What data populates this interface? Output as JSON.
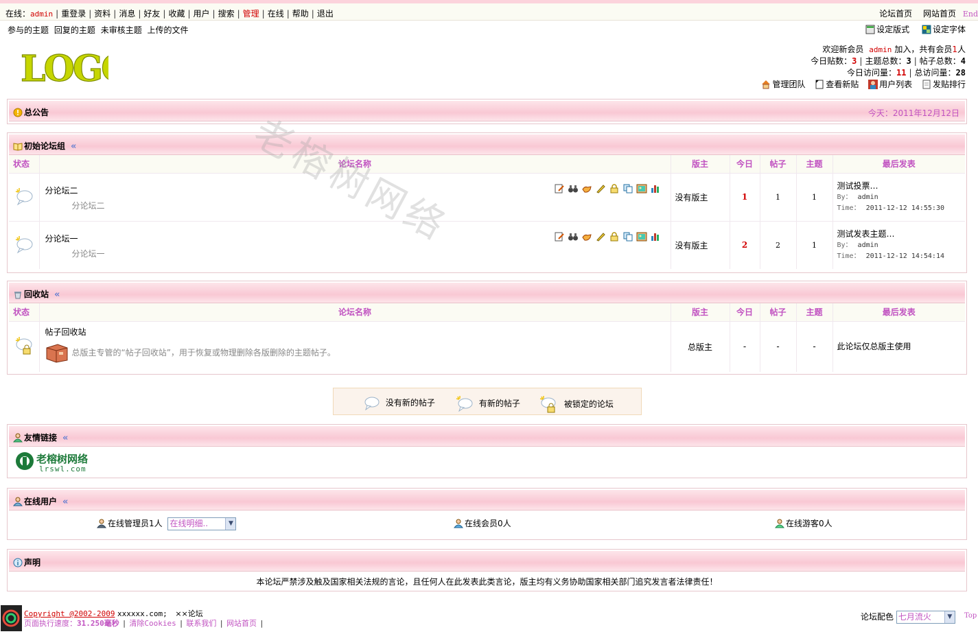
{
  "topbar": {
    "online_label": "在线：",
    "user": "admin",
    "menu": [
      "重登录",
      "资料",
      "消息",
      "好友",
      "收藏",
      "用户",
      "搜索",
      "管理",
      "在线",
      "帮助",
      "退出"
    ],
    "right_links": [
      "论坛首页",
      "网站首页",
      "End"
    ]
  },
  "subbar": {
    "links": [
      "参与的主题",
      "回复的主题",
      "未审核主题",
      "上传的文件"
    ]
  },
  "style_links": {
    "layout": "设定版式",
    "font": "设定字体"
  },
  "logo_text": "LOGO",
  "stats": {
    "welcome_pre": "欢迎新会员",
    "new_member": "admin",
    "welcome_mid": "加入，共有会员",
    "member_count": "1",
    "welcome_post": "人",
    "today_posts_label": "今日贴数：",
    "today_posts": "3",
    "topics_label": "主题总数：",
    "topics": "3",
    "posts_label": "帖子总数：",
    "posts": "4",
    "today_visits_label": "今日访问量：",
    "today_visits": "11",
    "total_visits_label": "总访问量：",
    "total_visits": "28",
    "links": [
      "管理团队",
      "查看新贴",
      "用户列表",
      "发贴排行"
    ]
  },
  "announcement": {
    "title": "总公告",
    "date": "今天：2011年12月12日"
  },
  "columns": [
    "状态",
    "论坛名称",
    "版主",
    "今日",
    "帖子",
    "主题",
    "最后发表"
  ],
  "group1": {
    "title": "初始论坛组",
    "forums": [
      {
        "name": "分论坛二",
        "desc": "分论坛二",
        "moderator": "没有版主",
        "today": "1",
        "posts": "1",
        "topics": "1",
        "last_title": "测试投票…",
        "by_label": "By：",
        "by": "admin",
        "time_label": "Time：",
        "time": "2011-12-12 14:55:30"
      },
      {
        "name": "分论坛一",
        "desc": "分论坛一",
        "moderator": "没有版主",
        "today": "2",
        "posts": "2",
        "topics": "1",
        "last_title": "测试发表主题…",
        "by_label": "By：",
        "by": "admin",
        "time_label": "Time：",
        "time": "2011-12-12 14:54:14"
      }
    ]
  },
  "recycle": {
    "title": "回收站",
    "name": "帖子回收站",
    "desc": "总版主专管的“帖子回收站”，用于恢复或物理删除各版删除的主题帖子。",
    "moderator": "总版主",
    "today": "-",
    "posts": "-",
    "topics": "-",
    "last": "此论坛仅总版主使用"
  },
  "legend": [
    "没有新的帖子",
    "有新的帖子",
    "被锁定的论坛"
  ],
  "friends": {
    "title": "友情链接",
    "logo_cn": "老榕树网络",
    "logo_url": "lrswl.com"
  },
  "online": {
    "title": "在线用户",
    "admins": "在线管理员1人",
    "select_value": "在线明细..",
    "members": "在线会员0人",
    "guests": "在线游客0人"
  },
  "statement": {
    "title": "声明",
    "text": "本论坛严禁涉及触及国家相关法规的言论，且任何人在此发表此类言论，版主均有义务协助国家相关部门追究发言者法律责任！"
  },
  "watermark": "老榕树网络",
  "footer": {
    "copyright": "Copyright @2002-2009",
    "site": "xxxxxx.com;",
    "forum": "××论坛",
    "exec_label": "页面执行速度：",
    "exec": "31.250毫秒",
    "links": [
      "清除Cookies",
      "联系我们",
      "网站首页"
    ],
    "color_label": "论坛配色",
    "color_value": "七月流火",
    "top": "Top"
  },
  "colors": {
    "accent": "#c153c1",
    "red": "#d10000",
    "pink_header": "#f9c8d4"
  }
}
